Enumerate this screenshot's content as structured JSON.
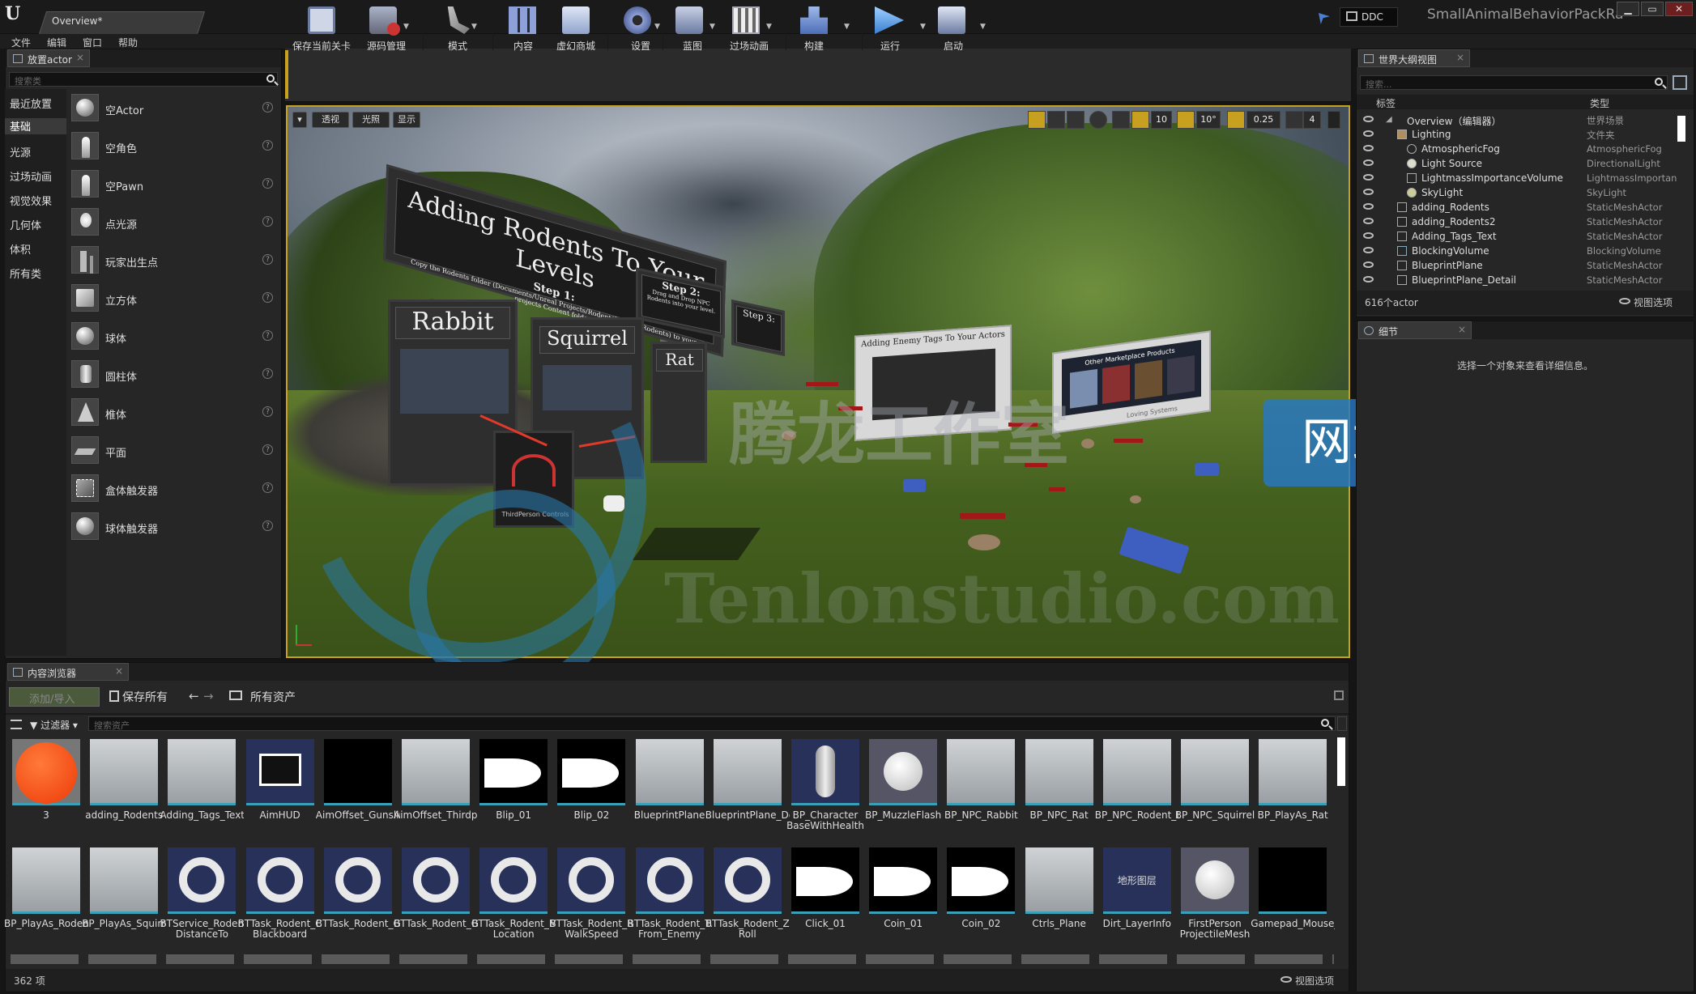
{
  "titlebar": {
    "doc_tab": "Overview*",
    "ddc": "DDC",
    "project_title": "SmallAnimalBehaviorPackRa",
    "win_min": "▁",
    "win_max": "▭",
    "win_close": "✕"
  },
  "menu": [
    "文件",
    "编辑",
    "窗口",
    "帮助"
  ],
  "place_actors": {
    "tab": "放置actor",
    "search_placeholder": "搜索类",
    "categories": [
      "最近放置",
      "基础",
      "光源",
      "过场动画",
      "视觉效果",
      "几何体",
      "体积",
      "所有类"
    ],
    "selected_category": "基础",
    "items": [
      {
        "label": "空Actor",
        "icon": "sphere-icon"
      },
      {
        "label": "空角色",
        "icon": "character-icon"
      },
      {
        "label": "空Pawn",
        "icon": "pawn-icon"
      },
      {
        "label": "点光源",
        "icon": "point-light-icon"
      },
      {
        "label": "玩家出生点",
        "icon": "player-start-icon"
      },
      {
        "label": "立方体",
        "icon": "cube-icon"
      },
      {
        "label": "球体",
        "icon": "sphere-icon"
      },
      {
        "label": "圆柱体",
        "icon": "cylinder-icon"
      },
      {
        "label": "椎体",
        "icon": "cone-icon"
      },
      {
        "label": "平面",
        "icon": "plane-icon"
      },
      {
        "label": "盒体触发器",
        "icon": "box-trigger-icon"
      },
      {
        "label": "球体触发器",
        "icon": "sphere-trigger-icon"
      }
    ],
    "help": "?"
  },
  "toolbar": {
    "buttons": [
      {
        "label": "保存当前关卡",
        "icon": "save-icon"
      },
      {
        "label": "源码管理",
        "icon": "source-control-icon"
      },
      {
        "label": "模式",
        "icon": "modes-icon"
      },
      {
        "label": "内容",
        "icon": "content-icon"
      },
      {
        "label": "虚幻商城",
        "icon": "marketplace-icon"
      },
      {
        "label": "设置",
        "icon": "settings-icon"
      },
      {
        "label": "蓝图",
        "icon": "blueprints-icon"
      },
      {
        "label": "过场动画",
        "icon": "cinematics-icon"
      },
      {
        "label": "构建",
        "icon": "build-icon"
      },
      {
        "label": "运行",
        "icon": "play-icon"
      },
      {
        "label": "启动",
        "icon": "launch-icon"
      }
    ]
  },
  "viewport": {
    "view_mode": "透视",
    "lighting": "光照",
    "show": "显示",
    "grid_snap": "10",
    "rot_snap": "10°",
    "scale_snap": "0.25",
    "camera_speed": "4",
    "scene_text": {
      "main_sign": "Adding Rodents To Your Levels",
      "step1": "Step 1:",
      "step1_body": "Copy the Rodents folder (Documents/Unreal Projects/Rodent/Content/Rodents) to your projects Content folder.",
      "step2": "Step 2:",
      "step2_body": "Drag and Drop NPC Rodents into your level.",
      "step3": "Step 3:",
      "rabbit": "Rabbit",
      "squirrel": "Squirrel",
      "rat": "Rat",
      "tags_board": "Adding Enemy Tags To Your Actors",
      "market_board": "Other Marketplace Products",
      "thirdperson": "ThirdPerson Controls",
      "lovely": "Loving Systems"
    }
  },
  "watermark": {
    "brand": "腾龙工作室",
    "site": "Tenlonstudio.com",
    "badge": "网站"
  },
  "outliner": {
    "tab": "世界大纲视图",
    "search_placeholder": "搜索...",
    "col_label": "标签",
    "col_type": "类型",
    "rows": [
      {
        "name": "Overview（编辑器）",
        "type": "世界场景",
        "indent": 0
      },
      {
        "name": "Lighting",
        "type": "文件夹",
        "indent": 1
      },
      {
        "name": "AtmosphericFog",
        "type": "AtmosphericFog",
        "indent": 2
      },
      {
        "name": "Light Source",
        "type": "DirectionalLight",
        "indent": 2
      },
      {
        "name": "LightmassImportanceVolume",
        "type": "LightmassImportan",
        "indent": 2
      },
      {
        "name": "SkyLight",
        "type": "SkyLight",
        "indent": 2
      },
      {
        "name": "adding_Rodents",
        "type": "StaticMeshActor",
        "indent": 1
      },
      {
        "name": "adding_Rodents2",
        "type": "StaticMeshActor",
        "indent": 1
      },
      {
        "name": "Adding_Tags_Text",
        "type": "StaticMeshActor",
        "indent": 1
      },
      {
        "name": "BlockingVolume",
        "type": "BlockingVolume",
        "indent": 1
      },
      {
        "name": "BlueprintPlane",
        "type": "StaticMeshActor",
        "indent": 1
      },
      {
        "name": "BlueprintPlane_Detail",
        "type": "StaticMeshActor",
        "indent": 1
      }
    ],
    "count": "616个actor",
    "view_options": "视图选项"
  },
  "details": {
    "tab": "细节",
    "empty_message": "选择一个对象来查看详细信息。"
  },
  "content_browser": {
    "tab": "内容浏览器",
    "add_import": "添加/导入",
    "save_all": "保存所有",
    "path": "所有资产",
    "filters": "过滤器",
    "search_placeholder": "搜索资产",
    "count": "362 项",
    "view_options": "视图选项",
    "row1": [
      {
        "name": "3",
        "kind": "orange"
      },
      {
        "name": "adding_Rodents",
        "kind": "mesh"
      },
      {
        "name": "Adding_Tags_Text",
        "kind": "mesh"
      },
      {
        "name": "AimHUD",
        "kind": "hud"
      },
      {
        "name": "AimOffset_Gunslinger",
        "kind": "black"
      },
      {
        "name": "AimOffset_Thirdperson",
        "kind": "mesh"
      },
      {
        "name": "Blip_01",
        "kind": "blip"
      },
      {
        "name": "Blip_02",
        "kind": "blip"
      },
      {
        "name": "BlueprintPlane",
        "kind": "mesh"
      },
      {
        "name": "BlueprintPlane_Detail",
        "kind": "mesh"
      },
      {
        "name": "BP_Character BaseWithHealth",
        "kind": "bpchar"
      },
      {
        "name": "BP_MuzzleFlash",
        "kind": "sphere"
      },
      {
        "name": "BP_NPC_Rabbit",
        "kind": "mesh"
      },
      {
        "name": "BP_NPC_Rat",
        "kind": "mesh"
      },
      {
        "name": "BP_NPC_Rodent_Base",
        "kind": "mesh"
      },
      {
        "name": "BP_NPC_Squirrel",
        "kind": "mesh"
      },
      {
        "name": "BP_PlayAs_Rat",
        "kind": "mesh"
      }
    ],
    "row2": [
      {
        "name": "BP_PlayAs_Rodent_Base",
        "kind": "mesh"
      },
      {
        "name": "BP_PlayAs_Squirrel",
        "kind": "mesh"
      },
      {
        "name": "BTService_Rodent_Get DistanceTo",
        "kind": "ring"
      },
      {
        "name": "BTTask_Rodent_ClearEnemy_In Blackboard",
        "kind": "ring"
      },
      {
        "name": "BTTask_Rodent_Get_Random_Rodent_Path",
        "kind": "ring"
      },
      {
        "name": "BTTask_Rodent_GetRandomPoint",
        "kind": "ring"
      },
      {
        "name": "BTTask_Rodent_MoveToEnemy Location",
        "kind": "ring"
      },
      {
        "name": "BTTask_Rodent_Random_Max WalkSpeed",
        "kind": "ring"
      },
      {
        "name": "BTTask_Rodent_TurnAndRun From_Enemy",
        "kind": "ring"
      },
      {
        "name": "BTTask_Rodent_ZeroOutPitchAnd Roll",
        "kind": "ring"
      },
      {
        "name": "Click_01",
        "kind": "blip"
      },
      {
        "name": "Coin_01",
        "kind": "blip"
      },
      {
        "name": "Coin_02",
        "kind": "blip"
      },
      {
        "name": "Ctrls_Plane",
        "kind": "mesh"
      },
      {
        "name": "Dirt_LayerInfo",
        "kind": "layer"
      },
      {
        "name": "FirstPerson ProjectileMesh",
        "kind": "sphere"
      },
      {
        "name": "Gamepad_Mouse_Ctrls_Glow",
        "kind": "black"
      }
    ],
    "layer_thumb_text": "地形图层"
  },
  "colors": {
    "accent": "#c8a020",
    "selection": "#3aa0b8",
    "panel": "#262626",
    "watermark_blue": "#2678c8"
  }
}
